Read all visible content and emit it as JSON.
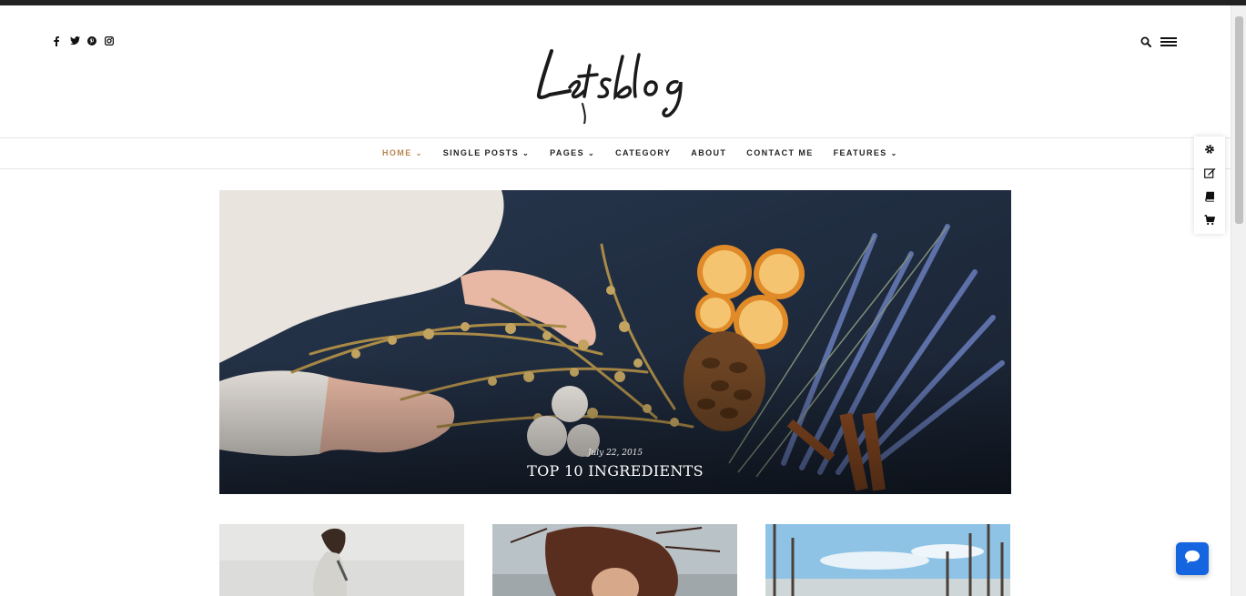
{
  "header": {
    "logo_text": "Letsblog",
    "social_icons": [
      "facebook-icon",
      "twitter-icon",
      "pinterest-icon",
      "instagram-icon"
    ],
    "tools": [
      "search-icon",
      "menu-icon"
    ]
  },
  "nav": {
    "items": [
      {
        "label": "HOME",
        "dropdown": true,
        "active": true
      },
      {
        "label": "SINGLE POSTS",
        "dropdown": true,
        "active": false
      },
      {
        "label": "PAGES",
        "dropdown": true,
        "active": false
      },
      {
        "label": "CATEGORY",
        "dropdown": false,
        "active": false
      },
      {
        "label": "ABOUT",
        "dropdown": false,
        "active": false
      },
      {
        "label": "CONTACT ME",
        "dropdown": false,
        "active": false
      },
      {
        "label": "FEATURES",
        "dropdown": true,
        "active": false
      }
    ],
    "caret": "⌄",
    "active_color": "#b8864f"
  },
  "side_tools": [
    "gear-icon",
    "edit-icon",
    "book-icon",
    "cart-icon"
  ],
  "featured": {
    "date": "July 22, 2015",
    "title": "TOP 10 INGREDIENTS"
  },
  "chat": {
    "icon": "chat-icon",
    "color": "#1565e0"
  }
}
